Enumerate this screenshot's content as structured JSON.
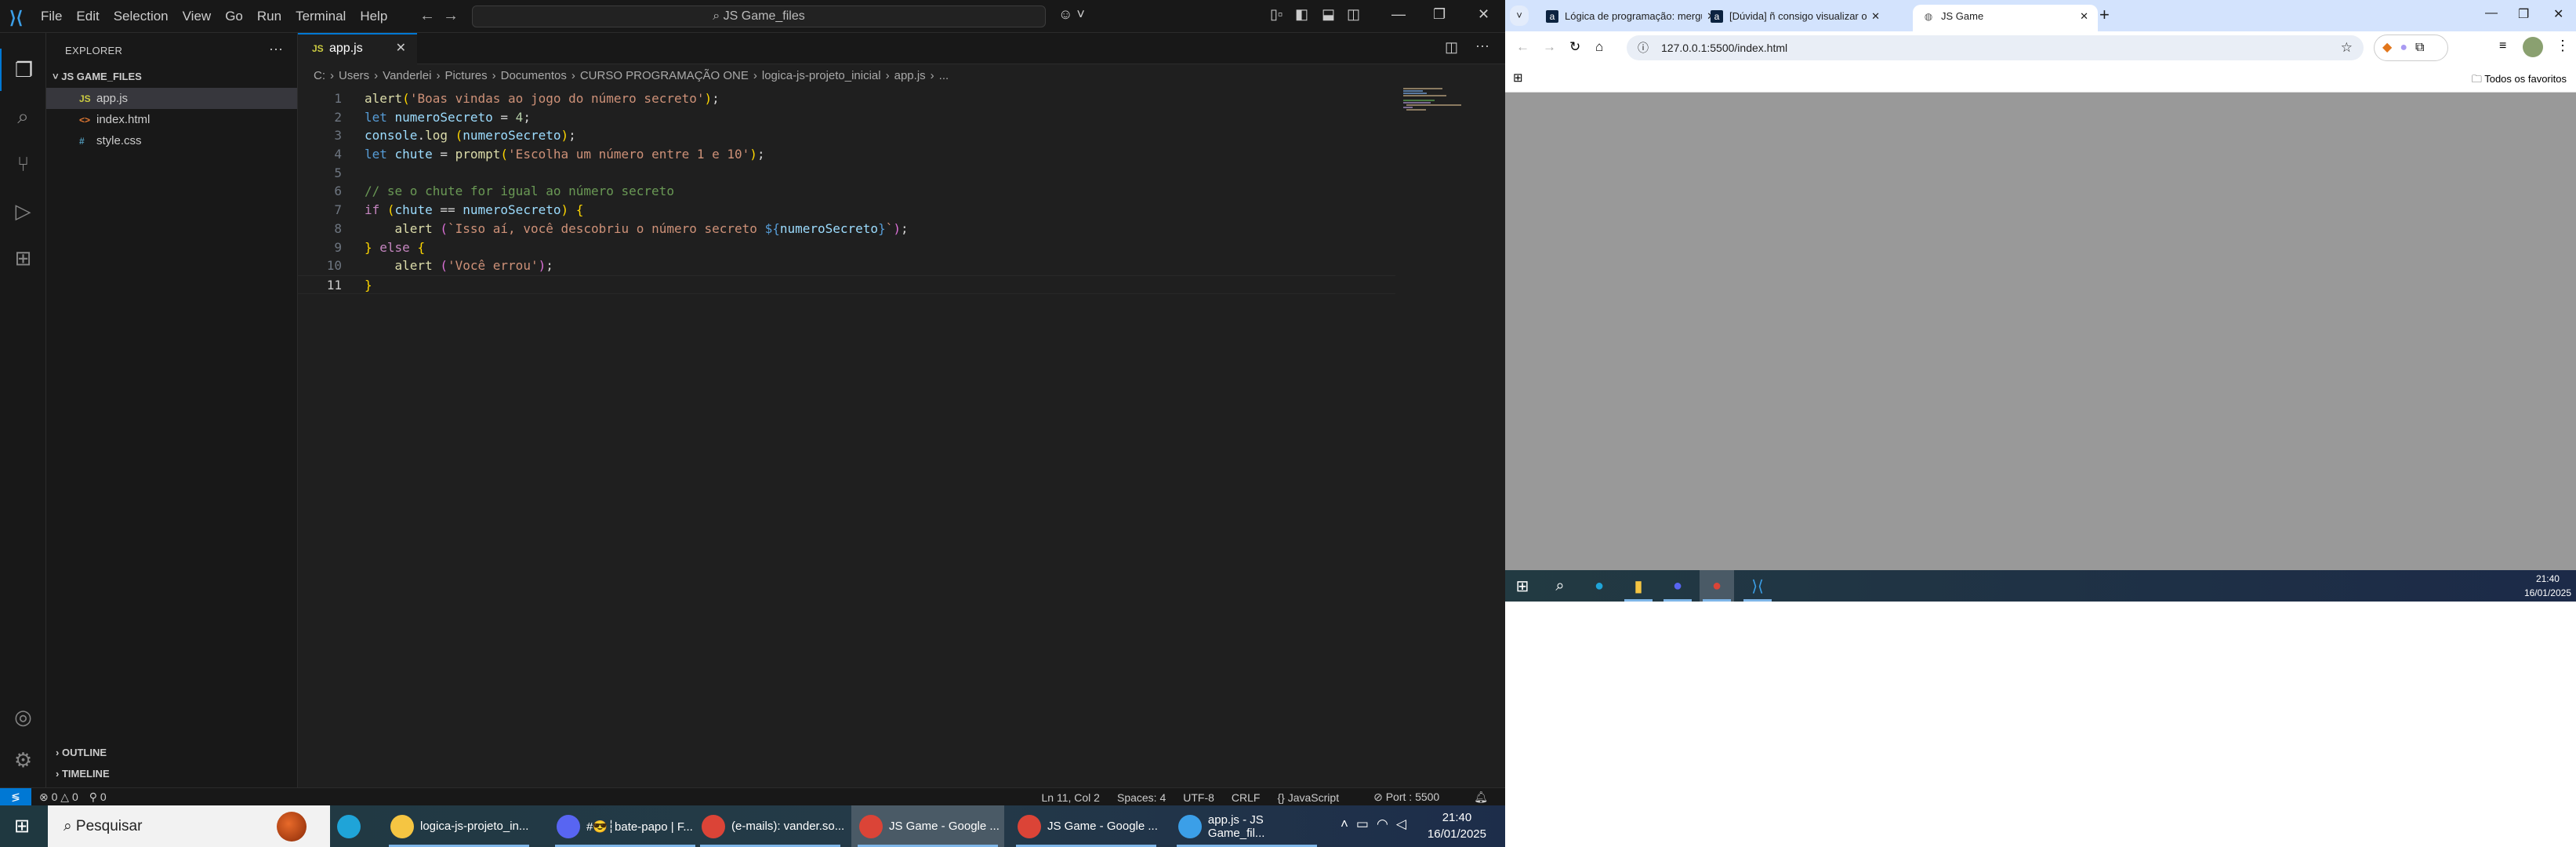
{
  "vscode": {
    "menu": [
      "File",
      "Edit",
      "Selection",
      "View",
      "Go",
      "Run",
      "Terminal",
      "Help"
    ],
    "command_center": "JS Game_files",
    "explorer": {
      "title": "EXPLORER",
      "folder": "JS GAME_FILES",
      "files": [
        {
          "name": "app.js",
          "icon": "JS",
          "color": "#cbcb41"
        },
        {
          "name": "index.html",
          "icon": "<>",
          "color": "#e37933"
        },
        {
          "name": "style.css",
          "icon": "#",
          "color": "#519aba"
        }
      ],
      "sections": [
        "OUTLINE",
        "TIMELINE"
      ]
    },
    "tab": {
      "label": "app.js",
      "icon": "JS"
    },
    "breadcrumb": [
      "C:",
      "Users",
      "Vanderlei",
      "Pictures",
      "Documentos",
      "CURSO PROGRAMAÇÃO ONE",
      "logica-js-projeto_inicial",
      "app.js",
      "..."
    ],
    "code": [
      [
        [
          "fn",
          "alert"
        ],
        [
          "b1",
          "("
        ],
        [
          "str",
          "'Boas vindas ao jogo do número secreto'"
        ],
        [
          "b1",
          ")"
        ],
        [
          "op",
          ";"
        ]
      ],
      [
        [
          "kw",
          "let "
        ],
        [
          "var",
          "numeroSecreto"
        ],
        [
          "op",
          " = "
        ],
        [
          "num",
          "4"
        ],
        [
          "op",
          ";"
        ]
      ],
      [
        [
          "var",
          "console"
        ],
        [
          "op",
          "."
        ],
        [
          "fn",
          "log"
        ],
        [
          "op",
          " "
        ],
        [
          "b1",
          "("
        ],
        [
          "var",
          "numeroSecreto"
        ],
        [
          "b1",
          ")"
        ],
        [
          "op",
          ";"
        ]
      ],
      [
        [
          "kw",
          "let "
        ],
        [
          "var",
          "chute"
        ],
        [
          "op",
          " = "
        ],
        [
          "fn",
          "prompt"
        ],
        [
          "b1",
          "("
        ],
        [
          "str",
          "'Escolha um número entre 1 e 10'"
        ],
        [
          "b1",
          ")"
        ],
        [
          "op",
          ";"
        ]
      ],
      [],
      [
        [
          "com",
          "// se o chute for igual ao número secreto"
        ]
      ],
      [
        [
          "ctl",
          "if "
        ],
        [
          "b1",
          "("
        ],
        [
          "var",
          "chute"
        ],
        [
          "op",
          " == "
        ],
        [
          "var",
          "numeroSecreto"
        ],
        [
          "b1",
          ")"
        ],
        [
          "op",
          " "
        ],
        [
          "b1",
          "{"
        ]
      ],
      [
        [
          "op",
          "    "
        ],
        [
          "fn",
          "alert"
        ],
        [
          "op",
          " "
        ],
        [
          "b2",
          "("
        ],
        [
          "str",
          "`Isso aí, você descobriu o número secreto "
        ],
        [
          "kw",
          "${"
        ],
        [
          "var",
          "numeroSecreto"
        ],
        [
          "kw",
          "}"
        ],
        [
          "str",
          "`"
        ],
        [
          "b2",
          ")"
        ],
        [
          "op",
          ";"
        ]
      ],
      [
        [
          "b1",
          "}"
        ],
        [
          "op",
          " "
        ],
        [
          "ctl",
          "else"
        ],
        [
          "op",
          " "
        ],
        [
          "b1",
          "{"
        ]
      ],
      [
        [
          "op",
          "    "
        ],
        [
          "fn",
          "alert"
        ],
        [
          "op",
          " "
        ],
        [
          "b2",
          "("
        ],
        [
          "str",
          "'Você errou'"
        ],
        [
          "b2",
          ")"
        ],
        [
          "op",
          ";"
        ]
      ],
      [
        [
          "b1",
          "}"
        ]
      ]
    ],
    "status": {
      "errors": "0",
      "warnings": "0",
      "ports": "0",
      "position": "Ln 11, Col 2",
      "spaces": "Spaces: 4",
      "encoding": "UTF-8",
      "eol": "CRLF",
      "language": "JavaScript",
      "port": "Port : 5500"
    }
  },
  "taskbar": {
    "search_placeholder": "Pesquisar",
    "apps": [
      {
        "label": "",
        "icon": "edge-icon",
        "color": "#1fa4d8"
      },
      {
        "label": "logica-js-projeto_in...",
        "icon": "folder-icon",
        "color": "#f5c542"
      },
      {
        "label": "#😎┆bate-papo | F...",
        "icon": "discord-icon",
        "color": "#5865f2"
      },
      {
        "label": "(e-mails): vander.so...",
        "icon": "chrome-icon",
        "color": "#db4437"
      },
      {
        "label": "JS Game - Google ...",
        "icon": "chrome-icon",
        "color": "#db4437",
        "active": true
      },
      {
        "label": "JS Game - Google ...",
        "icon": "chrome-icon",
        "color": "#db4437"
      },
      {
        "label": "app.js - JS Game_fil...",
        "icon": "vscode-icon",
        "color": "#3b9fe8"
      }
    ],
    "time": "21:40",
    "date": "16/01/2025"
  },
  "browser": {
    "tabs": [
      {
        "title": "Lógica de programação: mergu",
        "fav": "a"
      },
      {
        "title": "[Dúvida] ñ consigo visualizar o",
        "fav": "a"
      },
      {
        "title": "JS Game",
        "fav": "globe",
        "active": true
      }
    ],
    "url": "127.0.0.1:5500/index.html",
    "bookmarks_all": "Todos os favoritos",
    "inner_taskbar": {
      "time": "21:40",
      "date": "16/01/2025"
    }
  },
  "colors": {
    "accent": "#0078d4",
    "page_bg": "#999999",
    "tabstrip": "#d3e3fd"
  }
}
